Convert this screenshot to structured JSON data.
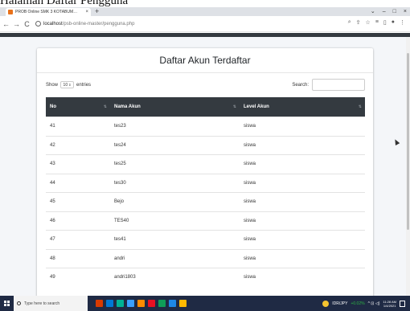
{
  "caption": "Halaman Daftar Pengguna",
  "browser": {
    "tab_title": "PROB Online SMK 3 KOTABUM…",
    "tab_close": "×",
    "new_tab": "+",
    "controls": [
      "⌄",
      "–",
      "□",
      "×"
    ],
    "nav": {
      "back": "←",
      "forward": "→",
      "reload": "C"
    },
    "url_host": "localhost",
    "url_path": "/psb-online-master/pengguna.php",
    "right_icons": [
      "⌕",
      "⇪",
      "☆",
      "≡",
      "▯",
      "●",
      "⋮"
    ]
  },
  "card": {
    "title": "Daftar Akun Terdaftar",
    "show_label": "Show",
    "entries_value": "10",
    "entries_label": "entries",
    "search_label": "Search:",
    "search_value": ""
  },
  "table": {
    "headers": [
      "No",
      "Nama Akun",
      "Level Akun"
    ],
    "rows": [
      [
        "41",
        "tes23",
        "siswa"
      ],
      [
        "42",
        "tes24",
        "siswa"
      ],
      [
        "43",
        "tes25",
        "siswa"
      ],
      [
        "44",
        "tes30",
        "siswa"
      ],
      [
        "45",
        "Bejo",
        "siswa"
      ],
      [
        "46",
        "TES40",
        "siswa"
      ],
      [
        "47",
        "tes41",
        "siswa"
      ],
      [
        "48",
        "andri",
        "siswa"
      ],
      [
        "49",
        "andri1803",
        "siswa"
      ]
    ]
  },
  "taskbar": {
    "search_placeholder": "Type here to search",
    "tray_ticker": "IDR/JPY",
    "tray_change": "+0.02%",
    "tray_misc": "^ ⊡ ◁)",
    "clock_time": "11:28 AM",
    "clock_date": "1/4/2021",
    "icon_colors": [
      "#d83b01",
      "#0078d4",
      "#00b294",
      "#3aa0ff",
      "#ff8c00",
      "#e81123",
      "#0f9d58",
      "#1e88e5",
      "#ffb900"
    ]
  },
  "colors": {
    "table_header_bg": "#343a40",
    "page_bg": "#f4f6f9",
    "taskbar_bg": "#1f2a44"
  }
}
